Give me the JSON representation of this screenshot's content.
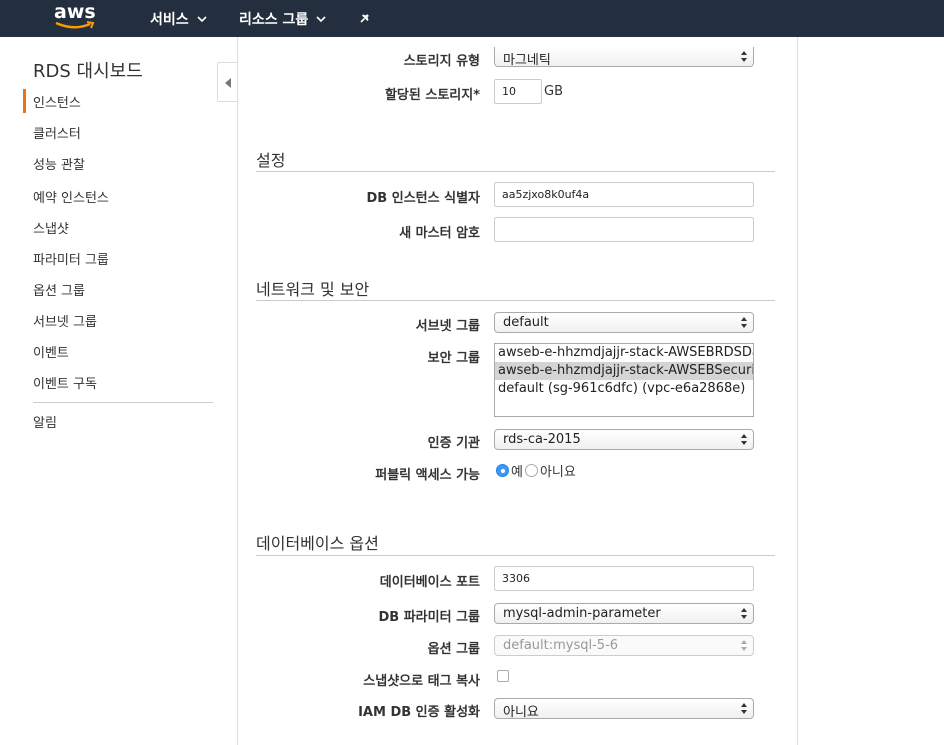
{
  "topbar": {
    "logo_text": "aws",
    "services_label": "서비스",
    "resource_groups_label": "리소스 그룹"
  },
  "sidebar": {
    "title": "RDS 대시보드",
    "items": [
      {
        "label": "인스턴스",
        "active": true
      },
      {
        "label": "클러스터"
      },
      {
        "label": "성능 관찰"
      },
      {
        "label": "예약 인스턴스"
      },
      {
        "label": "스냅샷"
      },
      {
        "label": "파라미터 그룹"
      },
      {
        "label": "옵션 그룹"
      },
      {
        "label": "서브넷 그룹"
      },
      {
        "label": "이벤트"
      },
      {
        "label": "이벤트 구독"
      }
    ],
    "extra_item": "알림"
  },
  "storage": {
    "type_label": "스토리지 유형",
    "type_value": "마그네틱",
    "allocated_label": "할당된 스토리지*",
    "allocated_value": "10",
    "allocated_unit": "GB"
  },
  "settings": {
    "title": "설정",
    "identifier_label": "DB 인스턴스 식별자",
    "identifier_value": "aa5zjxo8k0uf4a",
    "password_label": "새 마스터 암호",
    "password_value": ""
  },
  "network": {
    "title": "네트워크 및 보안",
    "subnet_label": "서브넷 그룹",
    "subnet_value": "default",
    "security_label": "보안 그룹",
    "security_options": [
      {
        "label": "awseb-e-hhzmdjajjr-stack-AWSEBRDSDatabaseSecurityGroup",
        "selected": false
      },
      {
        "label": "awseb-e-hhzmdjajjr-stack-AWSEBSecurityGroup",
        "selected": true
      },
      {
        "label": "default (sg-961c6dfc) (vpc-e6a2868e)",
        "selected": false
      }
    ],
    "ca_label": "인증 기관",
    "ca_value": "rds-ca-2015",
    "public_label": "퍼블릭 액세스 가능",
    "public_yes": "예",
    "public_no": "아니요",
    "public_selected": "예"
  },
  "db_options": {
    "title": "데이터베이스 옵션",
    "port_label": "데이터베이스 포트",
    "port_value": "3306",
    "param_group_label": "DB 파라미터 그룹",
    "param_group_value": "mysql-admin-parameter",
    "option_group_label": "옵션 그룹",
    "option_group_value": "default:mysql-5-6",
    "copy_tags_label": "스냅샷으로 태그 복사",
    "copy_tags_checked": false,
    "iam_label": "IAM DB 인증 활성화",
    "iam_value": "아니요"
  },
  "colors": {
    "topbar": "#232f3e",
    "accent": "#ec7211",
    "radio_on": "#3b99fc"
  }
}
